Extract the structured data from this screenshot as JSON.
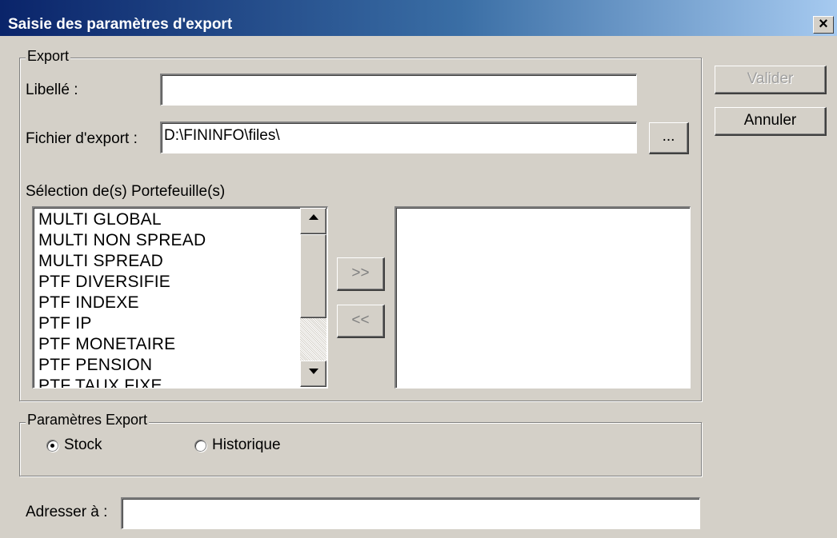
{
  "window": {
    "title": "Saisie des paramètres d'export",
    "close_label": "×"
  },
  "buttons": {
    "validate": "Valider",
    "cancel": "Annuler",
    "browse": "...",
    "add": ">>",
    "remove": "<<"
  },
  "export_group": {
    "legend": "Export",
    "libelle_label": "Libellé :",
    "libelle_value": "",
    "file_label": "Fichier d'export :",
    "file_value": "D:\\FININFO\\files\\",
    "selection_label": "Sélection de(s) Portefeuille(s)",
    "available_items": [
      "MULTI GLOBAL",
      "MULTI NON SPREAD",
      "MULTI SPREAD",
      "PTF DIVERSIFIE",
      "PTF INDEXE",
      "PTF IP",
      "PTF MONETAIRE",
      "PTF PENSION",
      "PTF TAUX FIXE"
    ],
    "selected_items": []
  },
  "params_group": {
    "legend": "Paramètres Export",
    "radio_stock": "Stock",
    "radio_history": "Historique",
    "selected": "Stock"
  },
  "address": {
    "label": "Adresser à :",
    "value": ""
  }
}
